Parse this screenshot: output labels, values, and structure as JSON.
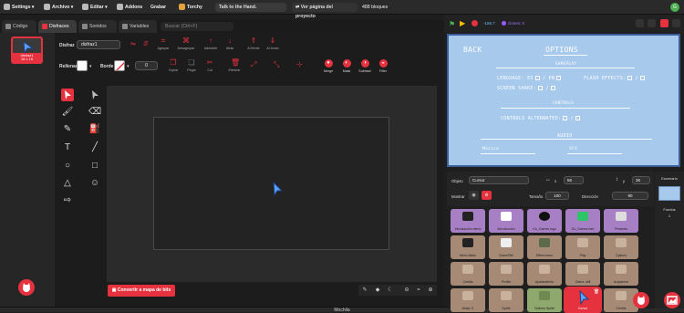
{
  "topbar": {
    "settings": "Settings",
    "archivo": "Archivo",
    "editar": "Editar",
    "addons": "Addons",
    "grabar": "Grabar",
    "torchy": "Torchy",
    "project_title": "Talk to the Hand.",
    "ver_pagina": "Ver página del proyecto",
    "block_count": "488 bloques"
  },
  "tabs": {
    "codigo": "Código",
    "disfraces": "Disfraces",
    "sonidos": "Sonidos",
    "variables": "Variables",
    "search_placeholder": "Buscar (Ctrl+F)"
  },
  "costume": {
    "name": "disfraz1",
    "size": "16 x 16"
  },
  "paint": {
    "disfraz_label": "Disfraz",
    "disfraz_value": "disfraz1",
    "rellenar_label": "Rellenar",
    "borde_label": "Borde",
    "borde_value": "0",
    "top_tools": [
      "Agrupar",
      "Desagrupar",
      "Adelante",
      "Atrás",
      "Al frente",
      "Al fondo"
    ],
    "copy_tools": [
      "Copiar",
      "Pegar",
      "Cut",
      "Eliminar"
    ],
    "shape_tools": [
      "Merge",
      "Mask",
      "Subtract",
      "Filter"
    ],
    "convert_button": "Convertir a mapa de bits"
  },
  "bottom_bar": "Mochila",
  "stage_header": {
    "fps": "-166.7",
    "clones": "clones: 0"
  },
  "game": {
    "back": "BACK",
    "options": "OPTIONS",
    "gameplay": "GAMEPLAY",
    "language": "LENGUAGE: ES",
    "en": "/ EN",
    "flash": "FLASH EFFECTS:",
    "shake": "SCREEN SHAKE:",
    "controls": "CONTROLS",
    "controls_alt": "CONTROLS ALTERNATED:",
    "audio": "AUDIO",
    "musica": "Música",
    "sfx": "SFX"
  },
  "sprite_info": {
    "objeto_label": "Objeto",
    "objeto_value": "Cursor",
    "x_value": "56",
    "y_value": "36",
    "mostrar_label": "Mostrar",
    "tamano_label": "Tamaño",
    "tamano_value": "100",
    "direccion_label": "Dirección",
    "direccion_value": "90"
  },
  "sprites": [
    {
      "name": "Introducción demo"
    },
    {
      "name": "Introducción"
    },
    {
      "name": "Go_Games logo"
    },
    {
      "name": "Go_Games font"
    },
    {
      "name": "Presents"
    },
    {
      "name": "Menu Mario"
    },
    {
      "name": "GameTitle"
    },
    {
      "name": "Effect menu"
    },
    {
      "name": "Play"
    },
    {
      "name": "Options"
    },
    {
      "name": "Credits"
    },
    {
      "name": "Profile"
    },
    {
      "name": "Ajustamiento"
    },
    {
      "name": "Game: still"
    },
    {
      "name": "la aparece"
    },
    {
      "name": "Music X"
    },
    {
      "name": "Sprite"
    },
    {
      "name": "Options Sprite"
    },
    {
      "name": "Cursor"
    },
    {
      "name": "Credits"
    }
  ],
  "stage_panel": {
    "title": "Escenario",
    "fondos_label": "Fondos",
    "fondos_count": "1"
  },
  "colors": {
    "accent": "#e6323e",
    "stage_bg": "#a6c9ec"
  }
}
